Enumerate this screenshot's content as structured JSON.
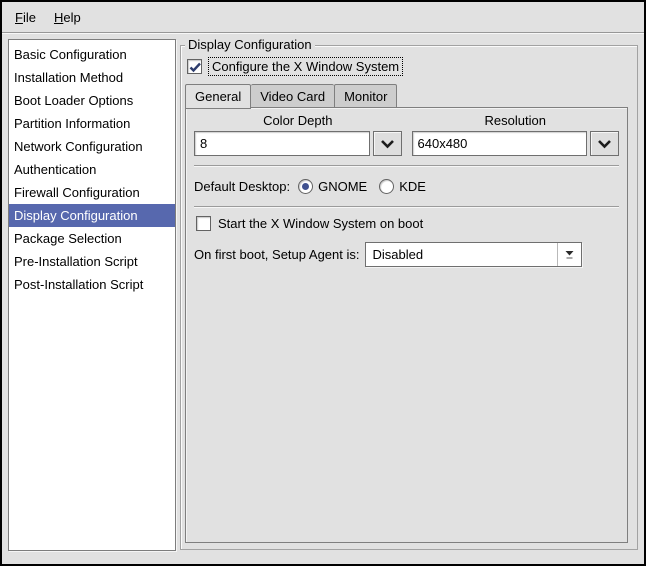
{
  "menu": {
    "items": [
      {
        "label": "File"
      },
      {
        "label": "Help"
      }
    ]
  },
  "sidebar": {
    "items": [
      {
        "label": "Basic Configuration",
        "selected": false
      },
      {
        "label": "Installation Method",
        "selected": false
      },
      {
        "label": "Boot Loader Options",
        "selected": false
      },
      {
        "label": "Partition Information",
        "selected": false
      },
      {
        "label": "Network Configuration",
        "selected": false
      },
      {
        "label": "Authentication",
        "selected": false
      },
      {
        "label": "Firewall Configuration",
        "selected": false
      },
      {
        "label": "Display Configuration",
        "selected": true
      },
      {
        "label": "Package Selection",
        "selected": false
      },
      {
        "label": "Pre-Installation Script",
        "selected": false
      },
      {
        "label": "Post-Installation Script",
        "selected": false
      }
    ]
  },
  "display_config": {
    "frame_title": "Display Configuration",
    "configure_x": {
      "label": "Configure the X Window System",
      "checked": true
    },
    "tabs": [
      {
        "label": "General",
        "active": true
      },
      {
        "label": "Video Card",
        "active": false
      },
      {
        "label": "Monitor",
        "active": false
      }
    ],
    "general": {
      "color_depth": {
        "header": "Color Depth",
        "value": "8"
      },
      "resolution": {
        "header": "Resolution",
        "value": "640x480"
      },
      "default_desktop": {
        "label": "Default Desktop:",
        "options": [
          {
            "label": "GNOME",
            "selected": true
          },
          {
            "label": "KDE",
            "selected": false
          }
        ]
      },
      "start_x": {
        "label": "Start the X Window System on boot",
        "checked": false
      },
      "setup_agent": {
        "label": "On first boot, Setup Agent is:",
        "value": "Disabled"
      }
    }
  },
  "colors": {
    "selection_blue": "#5768ae",
    "checkmark_navy": "#2e3d6e",
    "window_background": "#e1e1e1"
  }
}
